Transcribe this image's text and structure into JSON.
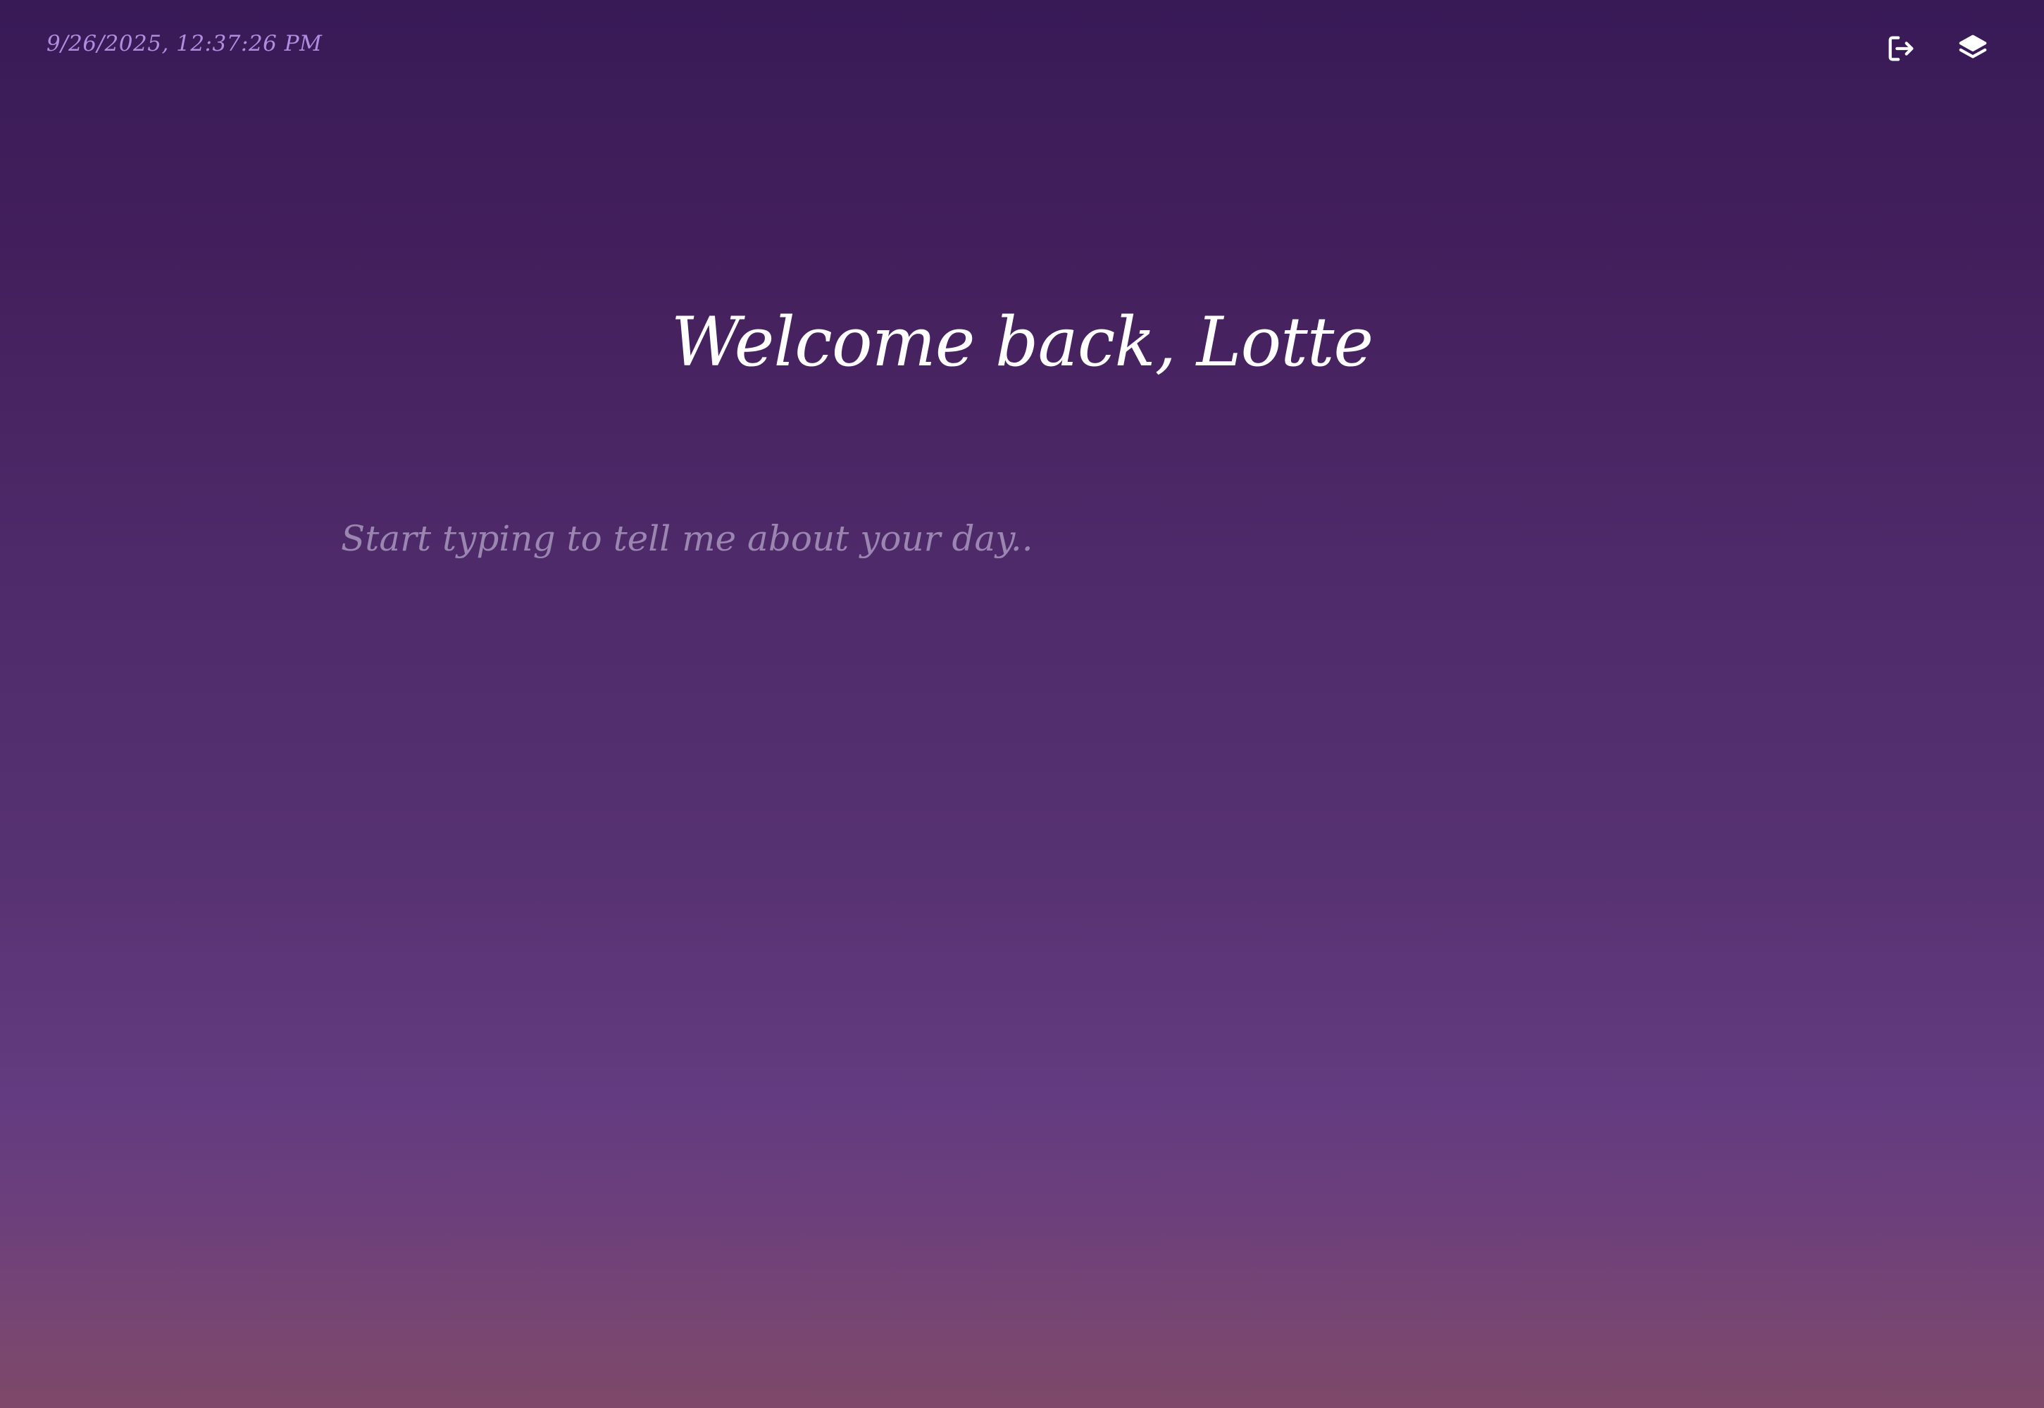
{
  "header": {
    "timestamp": "9/26/2025, 12:37:26 PM"
  },
  "toolbar": {
    "buttons": [
      {
        "icon": "logout-icon",
        "label": "Log out"
      },
      {
        "icon": "layers-icon",
        "label": "Entries"
      }
    ]
  },
  "main": {
    "welcome_text": "Welcome back, Lotte",
    "journal_placeholder": "Start typing to tell me about your day..",
    "journal_value": ""
  },
  "colors": {
    "background_top": "#381a57",
    "background_mid": "#633b80",
    "background_bottom": "#7e4868",
    "timestamp": "#b08de0",
    "text": "#ffffff",
    "placeholder": "#9a86b0"
  }
}
